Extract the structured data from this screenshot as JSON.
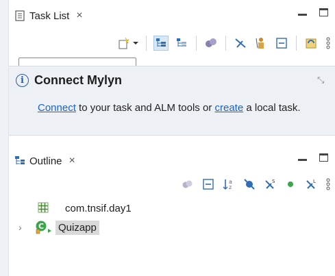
{
  "task_list": {
    "tab_label": "Task List",
    "close_glyph": "×",
    "icons": [
      "new-task-icon",
      "dropdown-arrow-icon",
      "categorized-icon",
      "scheduled-icon",
      "sphere-icon",
      "clear-icon",
      "person-icon",
      "collapse-icon",
      "sync-icon",
      "more-icon"
    ]
  },
  "mylyn": {
    "title": "Connect Mylyn",
    "info_glyph": "i",
    "close_glyph": "⤡",
    "link_connect": "Connect",
    "text_middle": " to your task and ALM tools or ",
    "link_create": "create",
    "text_end": " a local task."
  },
  "outline": {
    "tab_label": "Outline",
    "close_glyph": "×",
    "icons": [
      "sphere-icon",
      "collapse-all-icon",
      "sort-az-icon",
      "hide-fields-icon",
      "hide-static-icon",
      "hide-nonpublic-icon",
      "hide-local-types-icon",
      "more-icon"
    ],
    "tree": [
      {
        "label": "com.tnsif.day1",
        "kind": "package"
      },
      {
        "label": "Quizapp",
        "kind": "class",
        "selected": true
      }
    ]
  },
  "colors": {
    "accent_blue": "#1a62c9",
    "package_green": "#4c8a3a",
    "selection_gray": "#d9d9d9"
  }
}
